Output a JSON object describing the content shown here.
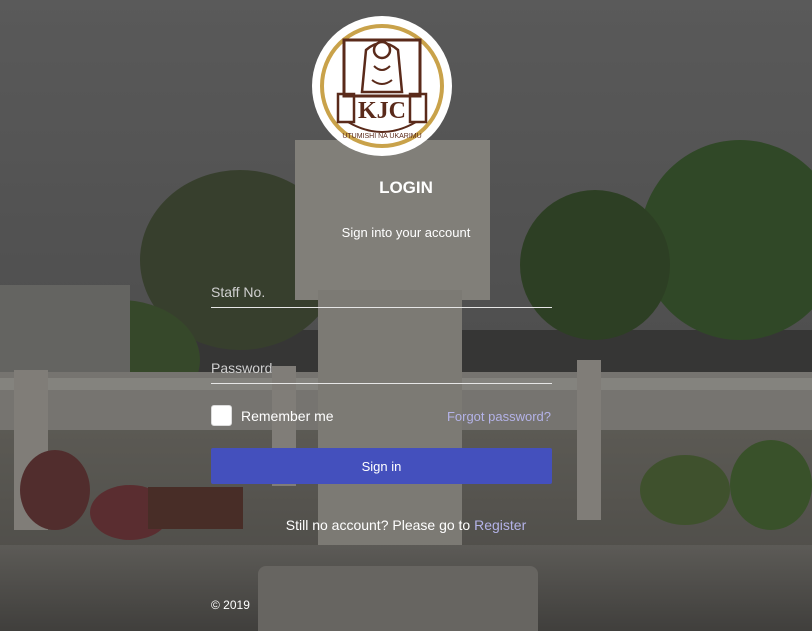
{
  "logo": {
    "initials": "KJC",
    "motto": "UTUMISHI NA UKARIMU",
    "colors": {
      "ink": "#5a2a1a",
      "gold": "#c9a24a"
    }
  },
  "login": {
    "title": "LOGIN",
    "subtitle": "Sign into your account"
  },
  "form": {
    "staff_placeholder": "Staff No.",
    "staff_value": "",
    "password_placeholder": "Password",
    "password_value": "",
    "remember_label": "Remember me",
    "remember_checked": false,
    "forgot_label": "Forgot password?",
    "signin_label": "Sign in"
  },
  "register": {
    "prompt": "Still no account? Please go to ",
    "link_label": "Register"
  },
  "footer": {
    "copyright": "© 2019"
  },
  "colors": {
    "accent": "#4450bd",
    "link": "#b4b3e8",
    "text": "#ffffff"
  }
}
